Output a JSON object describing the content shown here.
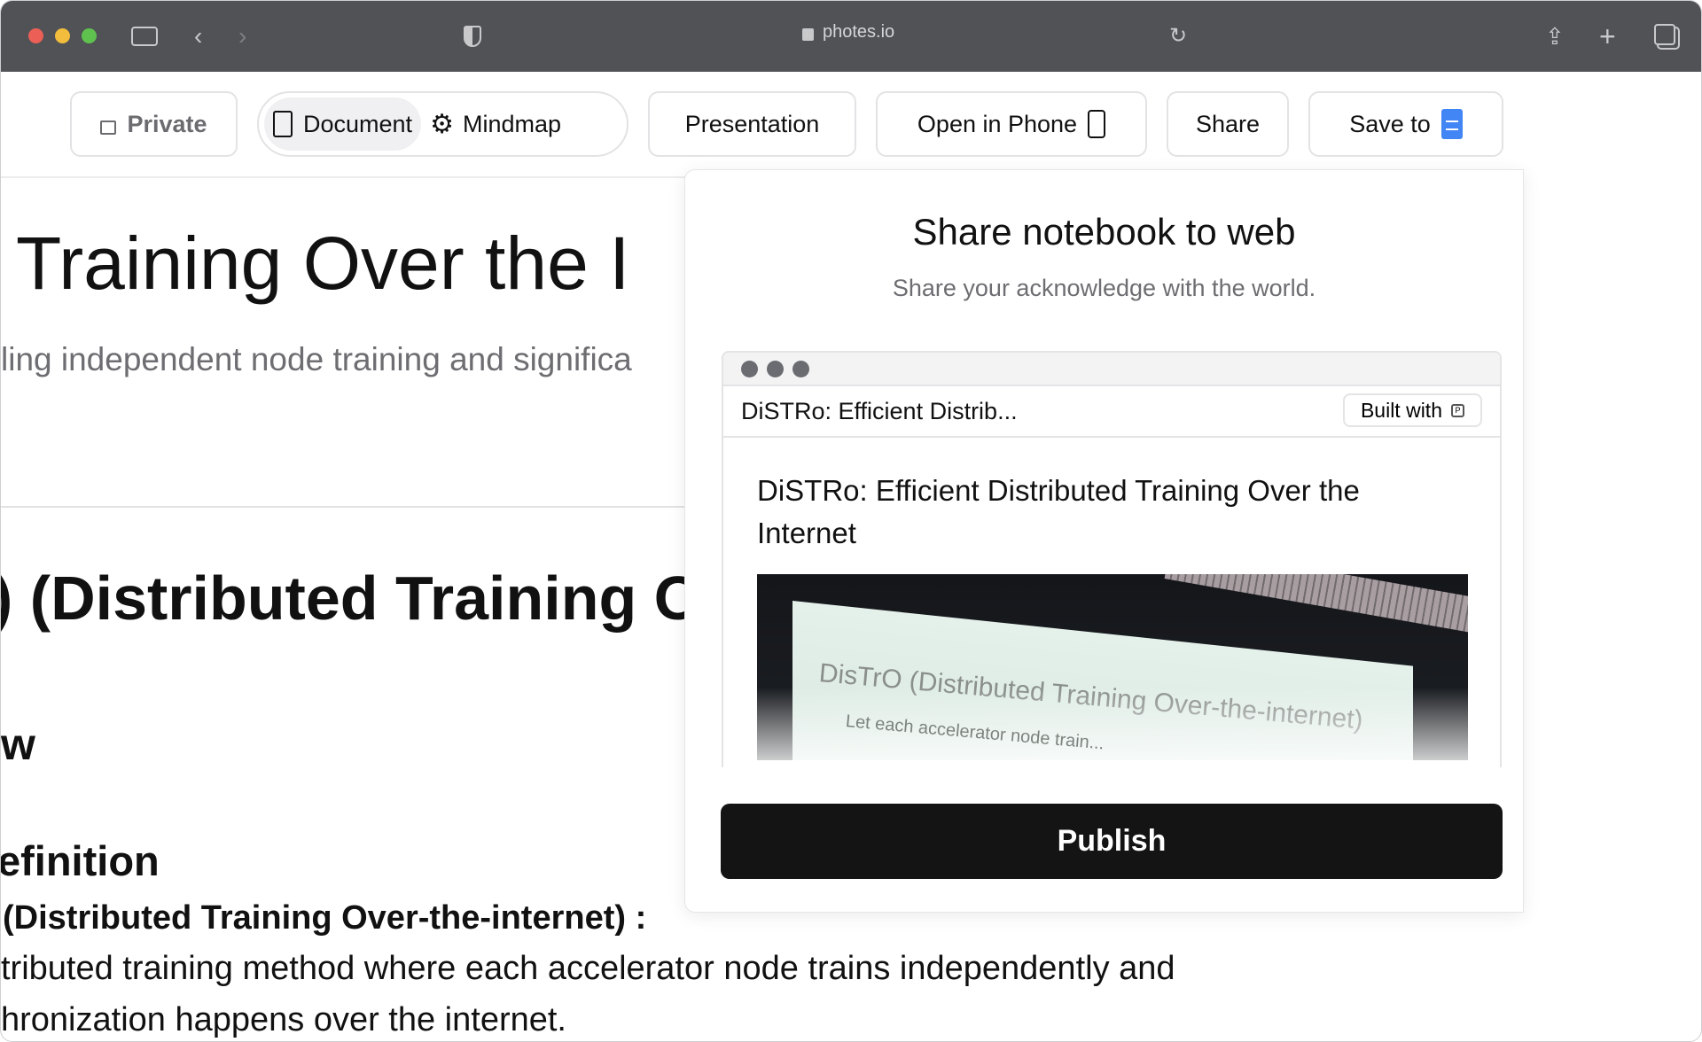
{
  "browser": {
    "url": "photes.io",
    "icons": [
      "sidebar-icon",
      "back-icon",
      "forward-icon",
      "shield-icon",
      "lock-icon",
      "reload-icon",
      "share-icon",
      "new-tab-icon",
      "tabs-icon"
    ]
  },
  "toolbar": {
    "private": "Private",
    "document": "Document",
    "mindmap": "Mindmap",
    "presentation": "Presentation",
    "open_phone": "Open in Phone",
    "share": "Share",
    "save_to": "Save to"
  },
  "document": {
    "title": "Training Over the I",
    "subtitle": "ling independent node training and significa",
    "h2": ") (Distributed Training O",
    "h3": "w",
    "h4": "efinition",
    "term": "(Distributed Training Over-the-internet) :",
    "line1": "tributed training method where each accelerator node trains independently and",
    "line2": "hronization happens over the internet."
  },
  "share_popup": {
    "title": "Share notebook to web",
    "subtitle": "Share your acknowledge with the world.",
    "preview": {
      "tab_title": "DiSTRo: Efficient Distrib...",
      "built_with": "Built with",
      "heading": "DiSTRo: Efficient Distributed Training Over the Internet",
      "image_text": "DisTrO (Distributed Training Over-the-internet)",
      "image_bullet": "Let each accelerator node train..."
    },
    "publish": "Publish"
  },
  "colors": {
    "titlebar": "#505256",
    "publish": "#141414",
    "docs_blue": "#4285f4"
  }
}
